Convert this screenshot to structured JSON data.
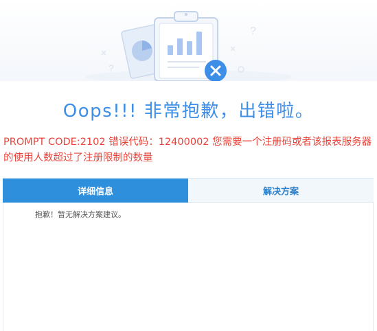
{
  "illustration": {
    "icons": [
      "clipboard-icon",
      "pie-chart-icon",
      "bar-chart-icon",
      "error-x-icon",
      "question-mark-icon"
    ]
  },
  "title": "Oops!!! 非常抱歉，出错啦。",
  "prompt_message": "PROMPT CODE:2102 错误代码：12400002 您需要一个注册码或者该报表服务器的使用人数超过了注册限制的数量",
  "tabs": [
    {
      "label": "详细信息",
      "active": true
    },
    {
      "label": "解决方案",
      "active": false
    }
  ],
  "panel": {
    "content": "抱歉！暂无解决方案建议。"
  },
  "colors": {
    "accent": "#2e8fdd",
    "title": "#3d8ee6",
    "error": "#e8443a"
  }
}
